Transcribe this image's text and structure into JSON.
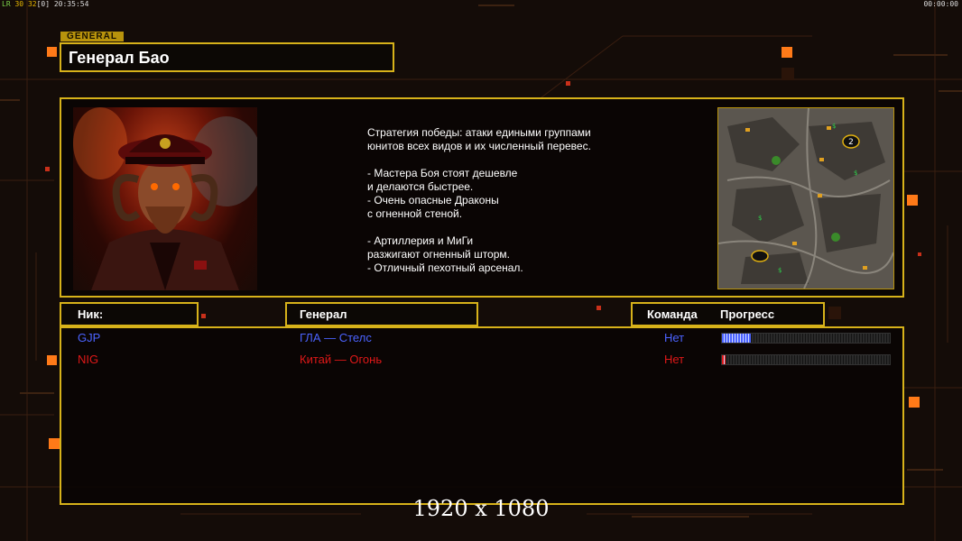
{
  "hud": {
    "left_prefix": "LR",
    "left_a": "30",
    "left_b": "32",
    "left_c": "[0]",
    "left_time": "20:35:54",
    "right_time": "00:00:00"
  },
  "colors": {
    "accent": "#d7b21a",
    "player_blue": "#4b63ff",
    "player_red": "#e01818"
  },
  "header": {
    "tag": "GENERAL",
    "title": "Генерал Бао"
  },
  "portrait": {
    "icon": "general-bao-portrait"
  },
  "description": {
    "para1": "Стратегия победы: атаки едиными группами\nюнитов всех видов и их численный перевес.",
    "para2": "- Мастера Боя стоят дешевле\nи делаются быстрее.\n- Очень опасные Драконы\nс огненной стеной.",
    "para3": "- Артиллерия и МиГи\nразжигают огненный шторм.\n- Отличный пехотный арсенал."
  },
  "minimap": {
    "start_marker": "2",
    "icon": "map-preview"
  },
  "columns": {
    "nick": "Ник:",
    "general": "Генерал",
    "team": "Команда",
    "progress": "Прогресс"
  },
  "players": [
    {
      "nick": "GJP",
      "general": "ГЛА — Стелс",
      "team": "Нет",
      "progress": 0.17,
      "color": "#4b63ff"
    },
    {
      "nick": "NIG",
      "general": "Китай — Огонь",
      "team": "Нет",
      "progress": 0.02,
      "color": "#e01818"
    }
  ],
  "footer": {
    "resolution": "1920 x 1080"
  }
}
